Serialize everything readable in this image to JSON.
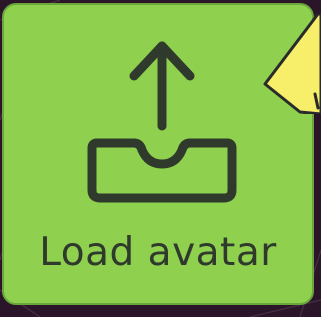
{
  "load_button": {
    "label": "Load avatar",
    "icon": "upload-icon"
  },
  "corner_badge": {
    "icon": "warning-icon"
  },
  "colors": {
    "button_fill": "#8fd14f",
    "button_border": "#6aa63a",
    "icon_stroke": "#2f3a2c",
    "background": "#2a1628",
    "badge_fill": "#f7ef6a"
  }
}
